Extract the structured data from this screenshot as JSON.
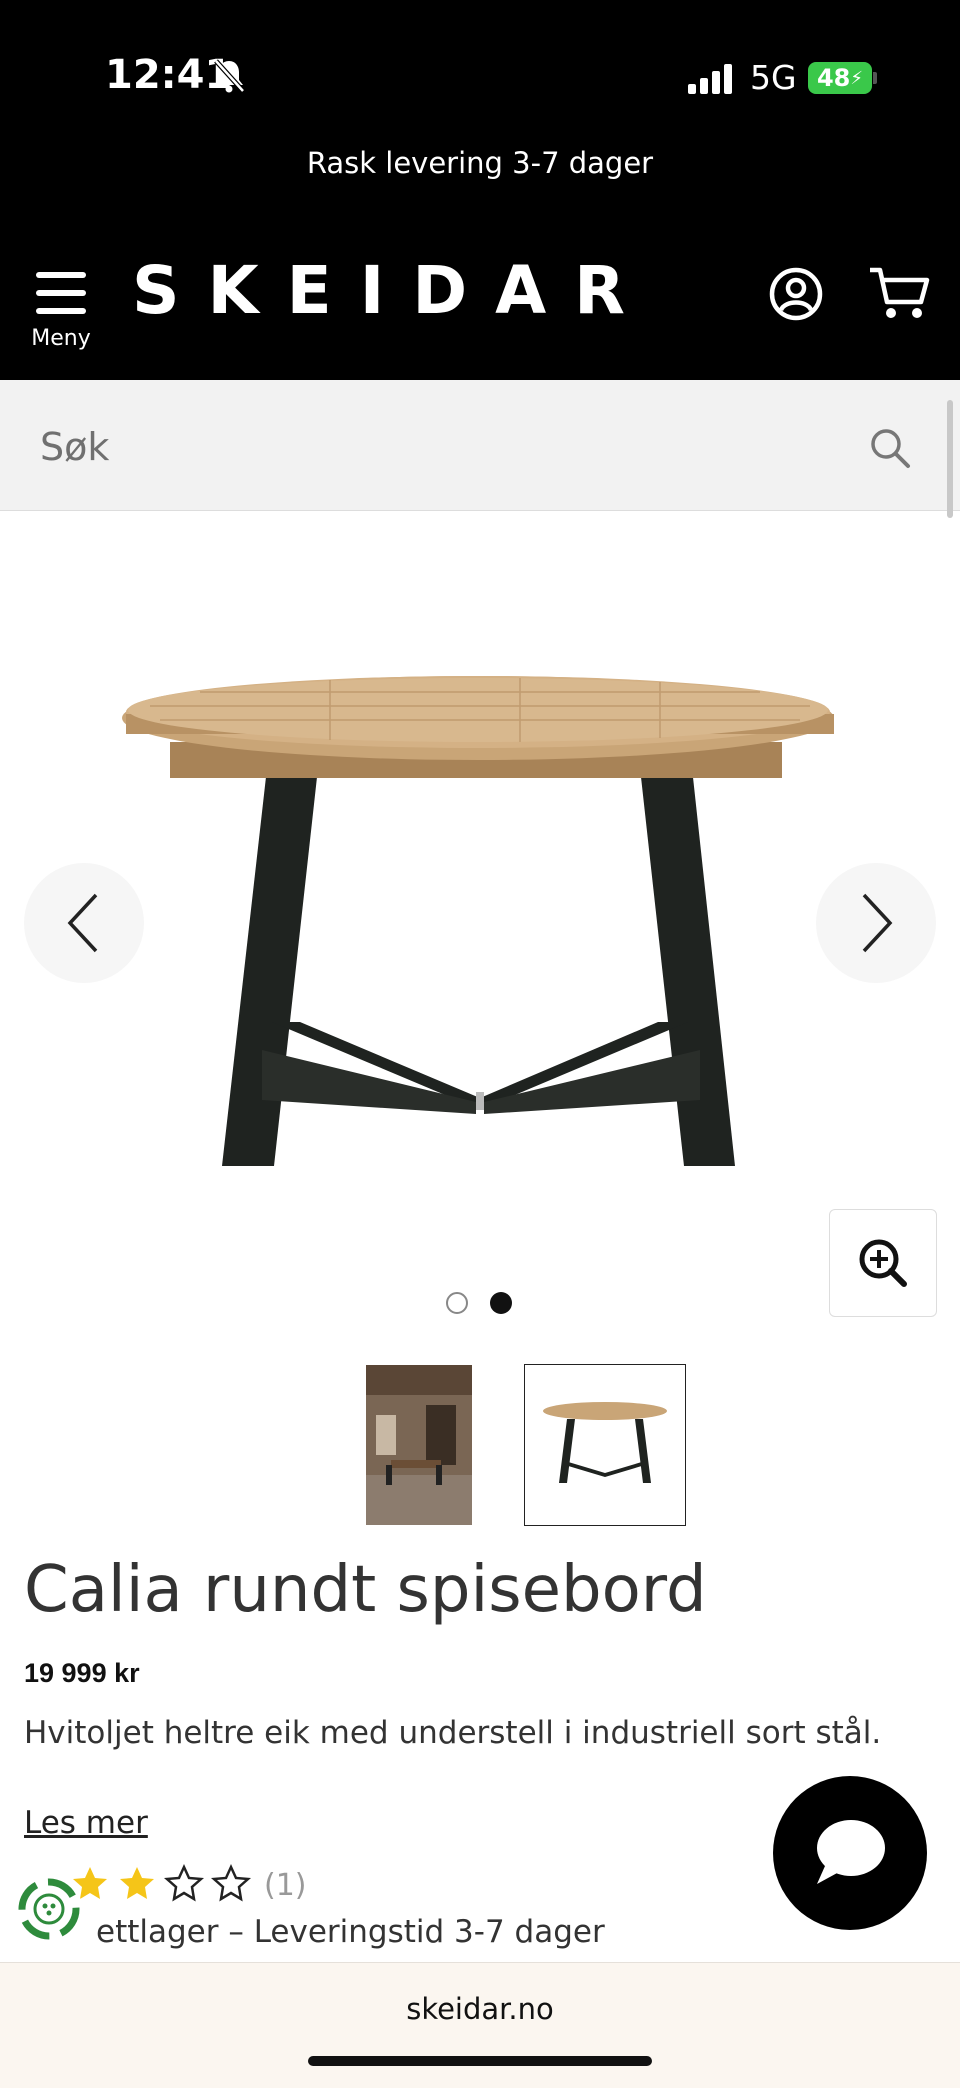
{
  "status_bar": {
    "time": "12:41",
    "network": "5G",
    "battery": "48"
  },
  "header": {
    "promo": "Rask levering 3-7 dager",
    "menu_label": "Meny",
    "logo": "SKEIDAR"
  },
  "search": {
    "placeholder": "Søk"
  },
  "gallery": {
    "image_count": 2,
    "active_index": 1
  },
  "product": {
    "title": "Calia rundt spisebord",
    "price": "19 999 kr",
    "description": "Hvitoljet heltre eik med understell i industriell sort stål.",
    "read_more": "Les mer",
    "rating": 2,
    "rating_max": 5,
    "rating_count": "(1)",
    "stock": "ettlager – Leveringstid 3-7 dager"
  },
  "browser": {
    "url": "skeidar.no"
  },
  "colors": {
    "header_bg": "#000000",
    "search_bg": "#f2f2f2",
    "star": "#f5c518",
    "battery": "#3ac84a",
    "eco_green": "#2e8b3c"
  }
}
